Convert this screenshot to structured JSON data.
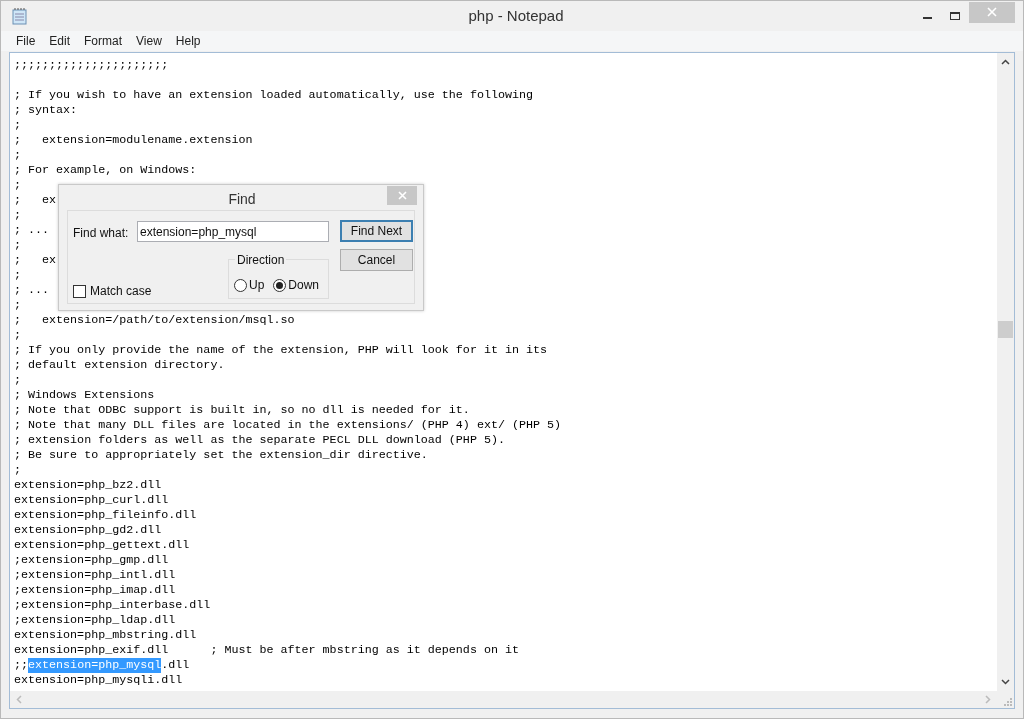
{
  "window": {
    "title": "php - Notepad"
  },
  "menu": [
    "File",
    "Edit",
    "Format",
    "View",
    "Help"
  ],
  "editor": {
    "lines": [
      {
        "kind": "text",
        "text": ";;;;;;;;;;;;;;;;;;;;;;"
      },
      {
        "kind": "blank"
      },
      {
        "kind": "text",
        "text": "; If you wish to have an extension loaded automatically, use the following"
      },
      {
        "kind": "text",
        "text": "; syntax:"
      },
      {
        "kind": "text",
        "text": ";"
      },
      {
        "kind": "text",
        "text": ";   extension=modulename.extension"
      },
      {
        "kind": "text",
        "text": ";"
      },
      {
        "kind": "text",
        "text": "; For example, on Windows:"
      },
      {
        "kind": "text",
        "text": ";"
      },
      {
        "kind": "text",
        "text": ";   ex"
      },
      {
        "kind": "text",
        "text": ";"
      },
      {
        "kind": "text",
        "text": "; ..."
      },
      {
        "kind": "text",
        "text": ";"
      },
      {
        "kind": "text",
        "text": ";   ex"
      },
      {
        "kind": "text",
        "text": ";"
      },
      {
        "kind": "text",
        "text": "; ..."
      },
      {
        "kind": "text",
        "text": ";"
      },
      {
        "kind": "text",
        "text": ";   extension=/path/to/extension/msql.so"
      },
      {
        "kind": "text",
        "text": ";"
      },
      {
        "kind": "text",
        "text": "; If you only provide the name of the extension, PHP will look for it in its"
      },
      {
        "kind": "text",
        "text": "; default extension directory."
      },
      {
        "kind": "text",
        "text": ";"
      },
      {
        "kind": "text",
        "text": "; Windows Extensions"
      },
      {
        "kind": "text",
        "text": "; Note that ODBC support is built in, so no dll is needed for it."
      },
      {
        "kind": "text",
        "text": "; Note that many DLL files are located in the extensions/ (PHP 4) ext/ (PHP 5)"
      },
      {
        "kind": "text",
        "text": "; extension folders as well as the separate PECL DLL download (PHP 5)."
      },
      {
        "kind": "text",
        "text": "; Be sure to appropriately set the extension_dir directive."
      },
      {
        "kind": "text",
        "text": ";"
      },
      {
        "kind": "text",
        "text": "extension=php_bz2.dll"
      },
      {
        "kind": "text",
        "text": "extension=php_curl.dll"
      },
      {
        "kind": "text",
        "text": "extension=php_fileinfo.dll"
      },
      {
        "kind": "text",
        "text": "extension=php_gd2.dll"
      },
      {
        "kind": "text",
        "text": "extension=php_gettext.dll"
      },
      {
        "kind": "text",
        "text": ";extension=php_gmp.dll"
      },
      {
        "kind": "text",
        "text": ";extension=php_intl.dll"
      },
      {
        "kind": "text",
        "text": ";extension=php_imap.dll"
      },
      {
        "kind": "text",
        "text": ";extension=php_interbase.dll"
      },
      {
        "kind": "text",
        "text": ";extension=php_ldap.dll"
      },
      {
        "kind": "text",
        "text": "extension=php_mbstring.dll"
      },
      {
        "kind": "text",
        "text": "extension=php_exif.dll      ; Must be after mbstring as it depends on it"
      },
      {
        "kind": "segments",
        "segments": [
          {
            "text": ";;",
            "selected": false
          },
          {
            "text": "extension=php_mysql",
            "selected": true
          },
          {
            "text": ".dll",
            "selected": false
          }
        ]
      },
      {
        "kind": "text",
        "text": "extension=php_mysqli.dll"
      }
    ]
  },
  "find_dialog": {
    "title": "Find",
    "find_what_label": "Find what:",
    "find_what_value": "extension=php_mysql",
    "match_case": {
      "label": "Match case",
      "checked": false
    },
    "direction": {
      "label": "Direction",
      "options": [
        {
          "label": "Up",
          "selected": false
        },
        {
          "label": "Down",
          "selected": true
        }
      ]
    },
    "buttons": [
      "Find Next",
      "Cancel"
    ]
  }
}
